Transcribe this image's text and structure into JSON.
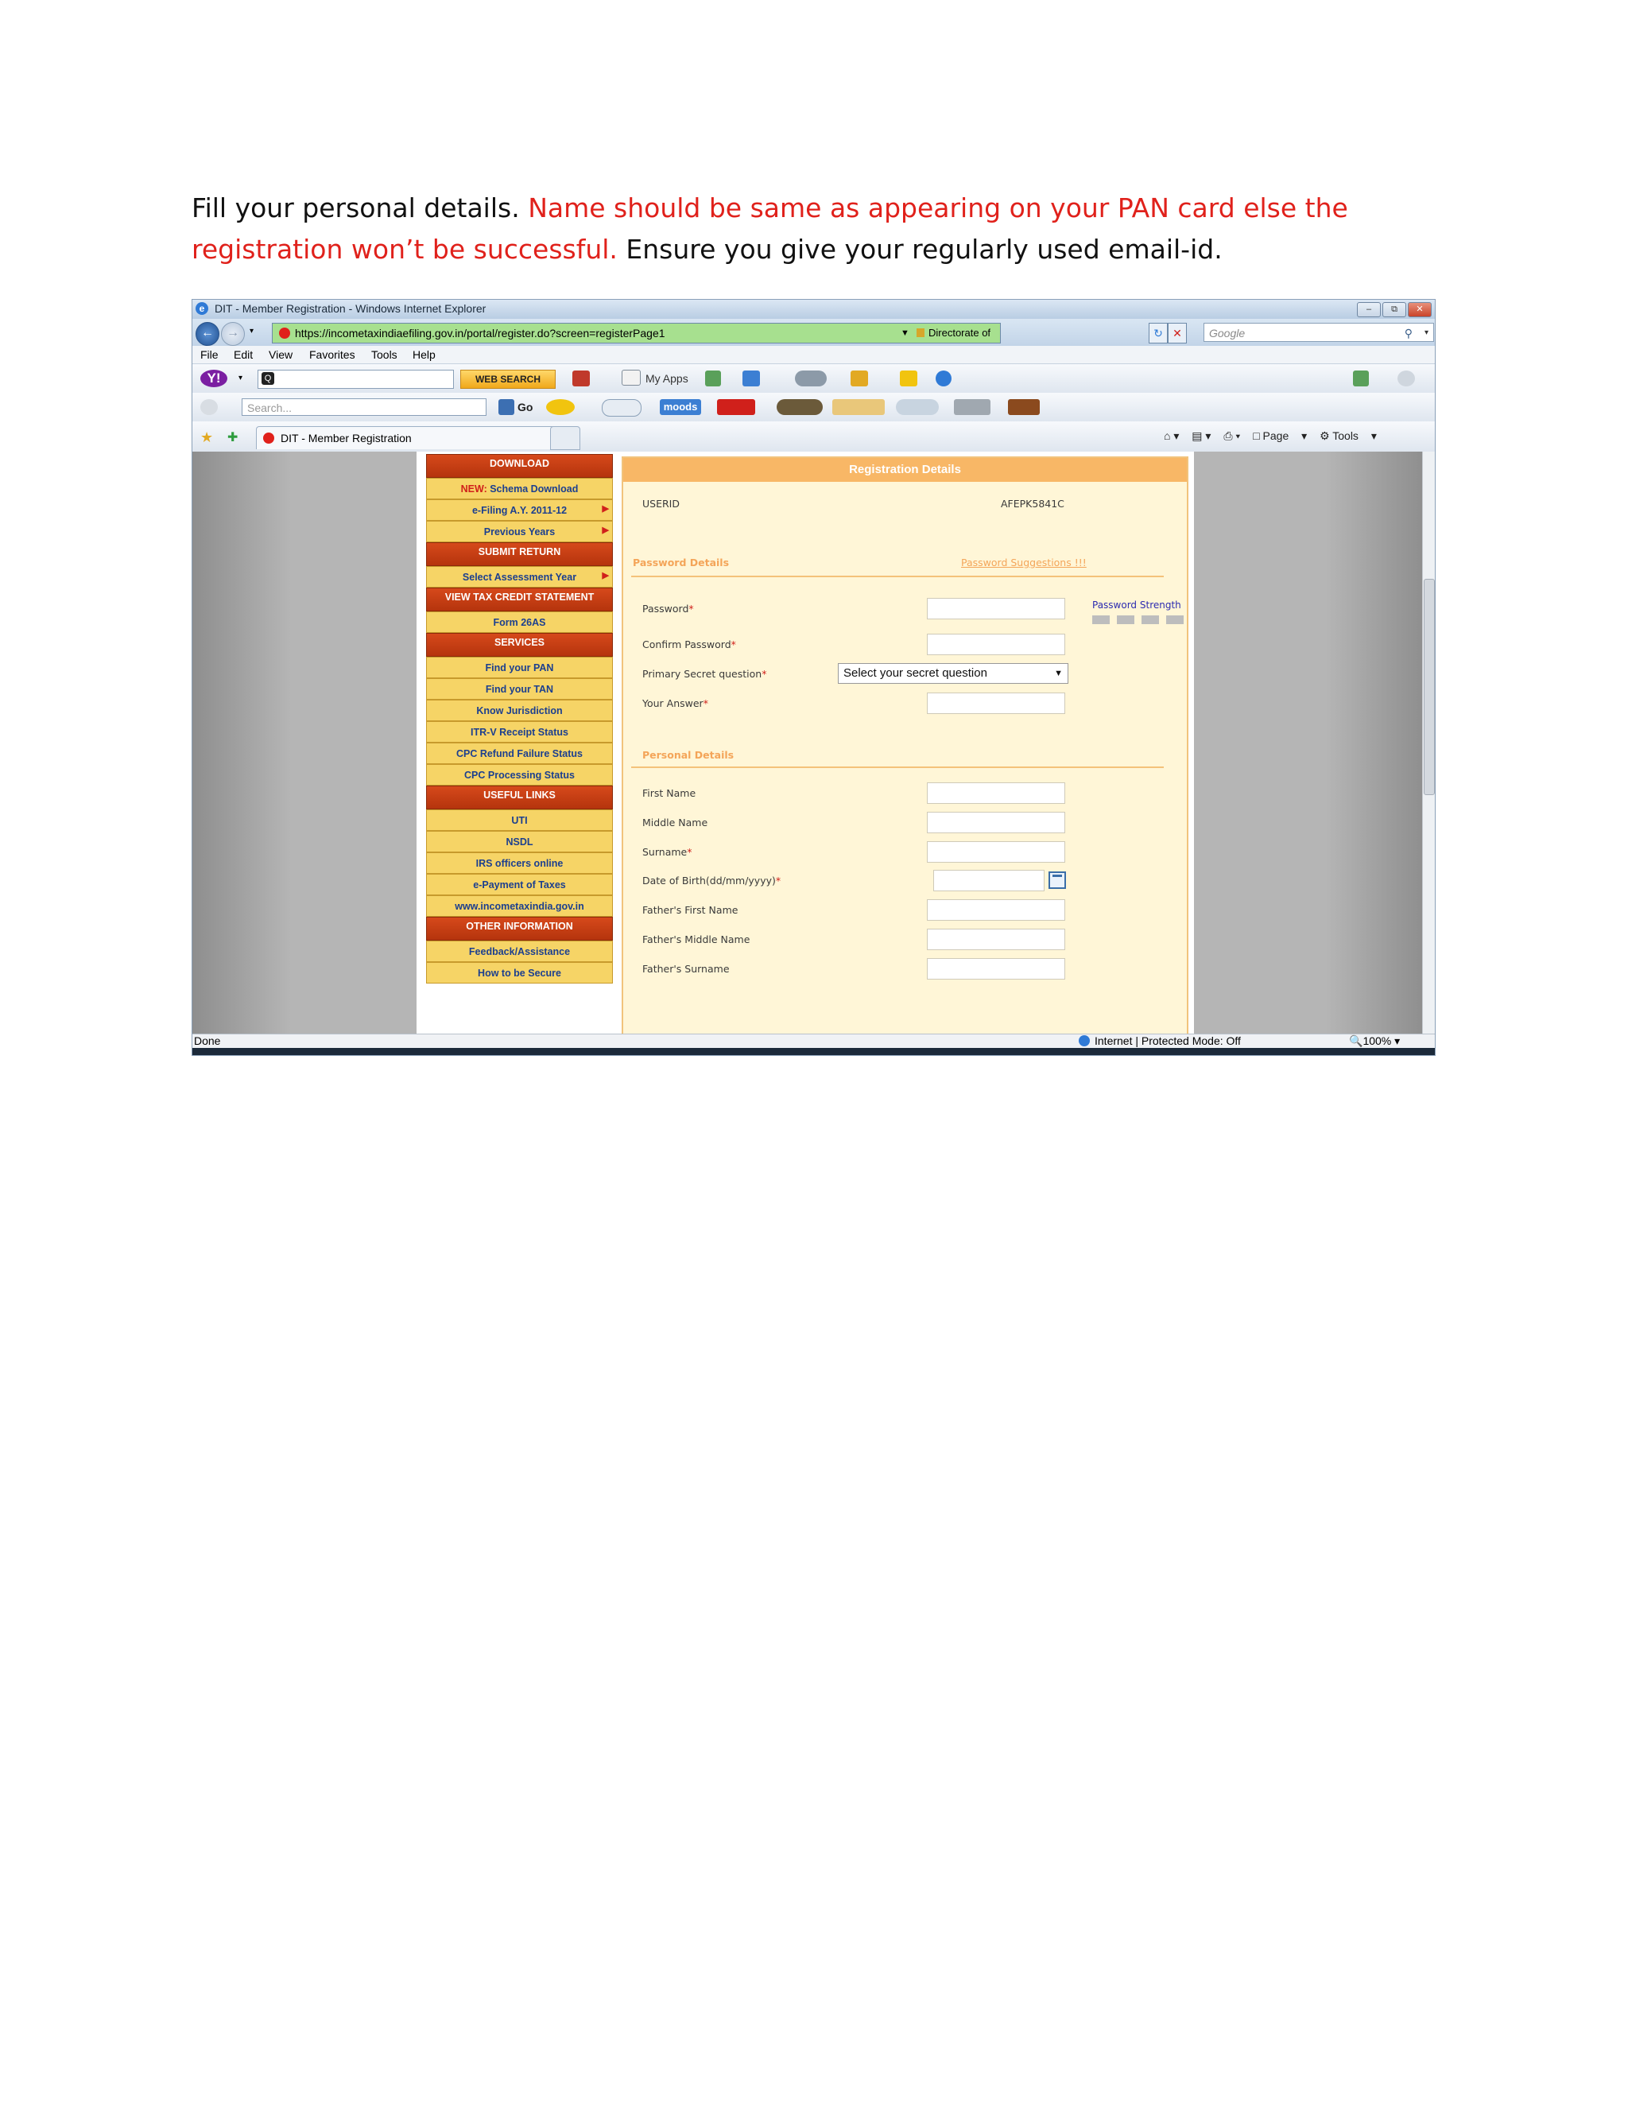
{
  "instructions": {
    "part1": "Fill your personal details.  ",
    "part2": "Name should be same as appearing on your PAN card else the registration won’t be successful.",
    "part3": " Ensure you give your regularly used email-id."
  },
  "browser": {
    "window_title": "DIT - Member Registration - Windows Internet Explorer",
    "url": "https://incometaxindiaefiling.gov.in/portal/register.do?screen=registerPage1",
    "cert_label": "Directorate of Income Tax (Systems) [IN]",
    "search_placeholder": "Google",
    "menu": [
      "File",
      "Edit",
      "View",
      "Favorites",
      "Tools",
      "Help"
    ],
    "web_search_label": "WEB SEARCH",
    "my_apps_label": "My Apps",
    "search2_placeholder": "Search...",
    "go_label": "Go",
    "moods_label": "moods",
    "tab_title": "DIT - Member Registration",
    "page_menu": "Page",
    "tools_menu": "Tools",
    "status_done": "Done",
    "status_zone": "Internet | Protected Mode: Off",
    "zoom": "100%"
  },
  "left_nav": {
    "download": "DOWNLOAD",
    "new_label": "NEW:",
    "schema_download": " Schema Download",
    "efiling": "e-Filing A.Y. 2011-12",
    "previous_years": "Previous Years",
    "submit_return": "SUBMIT RETURN",
    "select_ay": "Select Assessment Year",
    "view_tax_credit": "VIEW TAX CREDIT STATEMENT",
    "form26as": "Form 26AS",
    "services": "SERVICES",
    "find_pan": "Find your PAN",
    "find_tan": "Find your TAN",
    "know_jurisdiction": "Know Jurisdiction",
    "itrv_status": "ITR-V Receipt Status",
    "cpc_refund": "CPC Refund Failure Status",
    "cpc_processing": "CPC Processing Status",
    "useful_links": "USEFUL LINKS",
    "uti": "UTI",
    "nsdl": "NSDL",
    "irs_officers": "IRS officers online",
    "epayment": "e-Payment of Taxes",
    "website": "www.incometaxindia.gov.in",
    "other_info": "OTHER INFORMATION",
    "feedback": "Feedback/Assistance",
    "how_secure": "How to be Secure"
  },
  "form": {
    "heading": "Registration Details",
    "userid_label": "USERID",
    "userid_value": "AFEPK5841C",
    "password_section": "Password Details",
    "password_suggestions": "Password Suggestions !!!",
    "password_label": "Password",
    "confirm_password_label": "Confirm Password",
    "secret_question_label": "Primary Secret question",
    "secret_question_value": "Select your secret question",
    "answer_label": "Your Answer",
    "password_strength": "Password Strength",
    "personal_section": "Personal Details",
    "first_name_label": "First Name",
    "middle_name_label": "Middle Name",
    "surname_label": "Surname",
    "dob_label": "Date of Birth(dd/mm/yyyy)",
    "father_first_label": "Father's First Name",
    "father_middle_label": "Father's Middle Name",
    "father_surname_label": "Father's Surname",
    "required_mark": "*"
  }
}
